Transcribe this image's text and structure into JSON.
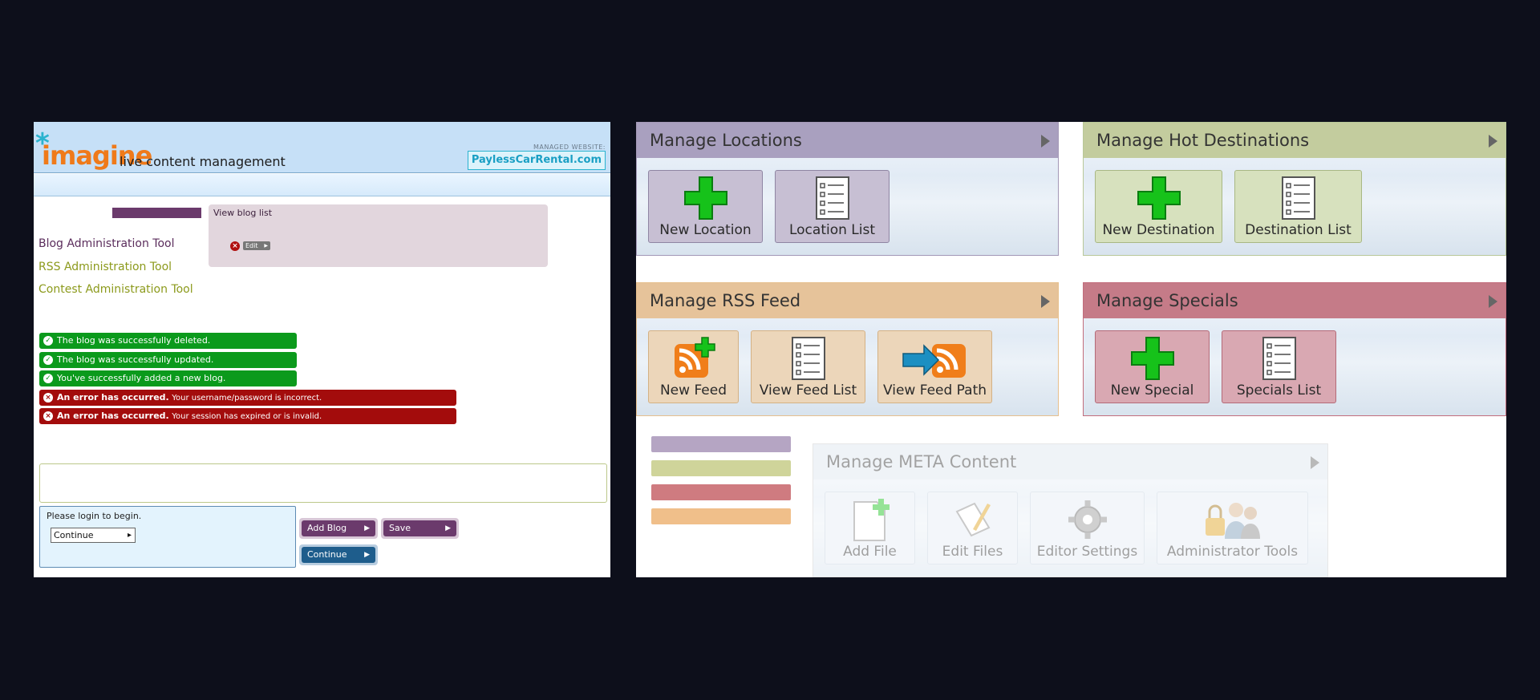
{
  "left": {
    "logo": {
      "mark": "*",
      "word": "imagine",
      "tagline": "live content management"
    },
    "managed": {
      "label": "MANAGED WEBSITE:",
      "site": "PaylessCarRental.com"
    },
    "nav": [
      {
        "label": "Blog Administration Tool"
      },
      {
        "label": "RSS Administration Tool"
      },
      {
        "label": "Contest Administration Tool"
      }
    ],
    "blog_list": {
      "title": "View blog list",
      "delete_icon": "x-circle-icon",
      "edit_label": "Edit"
    },
    "messages": [
      {
        "type": "success",
        "text": "The blog was successfully deleted.",
        "icon": "check-circle-icon"
      },
      {
        "type": "success",
        "text": "The blog was successfully updated.",
        "icon": "check-circle-icon"
      },
      {
        "type": "success",
        "text": "You've successfully added a new blog.",
        "icon": "check-circle-icon"
      },
      {
        "type": "error",
        "bold": "An error has occurred.",
        "text": "Your username/password is incorrect.",
        "icon": "x-circle-icon"
      },
      {
        "type": "error",
        "bold": "An error has occurred.",
        "text": "Your session has expired or is invalid.",
        "icon": "x-circle-icon"
      }
    ],
    "login": {
      "message": "Please login to begin.",
      "continue_label": "Continue"
    },
    "buttons": {
      "add_blog": "Add Blog",
      "save": "Save",
      "continue": "Continue"
    },
    "colors": {
      "header_bg": "#c6e0f7",
      "logo_orange": "#ef7a1a",
      "logo_star": "#2bb3cf",
      "blog_purple": "#6b3a6c",
      "success_green": "#0b9a1c",
      "error_red": "#a30c0c"
    }
  },
  "right": {
    "sections": [
      {
        "title": "Manage Locations",
        "tiles": [
          {
            "label": "New Location",
            "icon": "plus-icon"
          },
          {
            "label": "Location List",
            "icon": "list-icon"
          }
        ]
      },
      {
        "title": "Manage Hot Destinations",
        "tiles": [
          {
            "label": "New Destination",
            "icon": "plus-icon"
          },
          {
            "label": "Destination List",
            "icon": "list-icon"
          }
        ]
      },
      {
        "title": "Manage RSS Feed",
        "tiles": [
          {
            "label": "New Feed",
            "icon": "rss-plus-icon"
          },
          {
            "label": "View Feed List",
            "icon": "list-icon"
          },
          {
            "label": "View Feed Path",
            "icon": "rss-arrow-icon"
          }
        ]
      },
      {
        "title": "Manage Specials",
        "tiles": [
          {
            "label": "New Special",
            "icon": "plus-icon"
          },
          {
            "label": "Specials List",
            "icon": "list-icon"
          }
        ]
      }
    ],
    "meta": {
      "title": "Manage META Content",
      "tiles": [
        {
          "label": "Add File",
          "icon": "add-file-icon"
        },
        {
          "label": "Edit Files",
          "icon": "edit-file-icon"
        },
        {
          "label": "Editor Settings",
          "icon": "gear-icon"
        },
        {
          "label": "Administrator Tools",
          "icon": "admin-users-icon"
        }
      ]
    },
    "swatches": [
      "#b5a5c3",
      "#cfd49a",
      "#cf7b80",
      "#f0bf8a"
    ],
    "colors": {
      "locations": "#a9a0bf",
      "hot_destinations": "#c3cc9e",
      "rss_feed": "#e6c39a",
      "specials": "#c57b88"
    }
  }
}
